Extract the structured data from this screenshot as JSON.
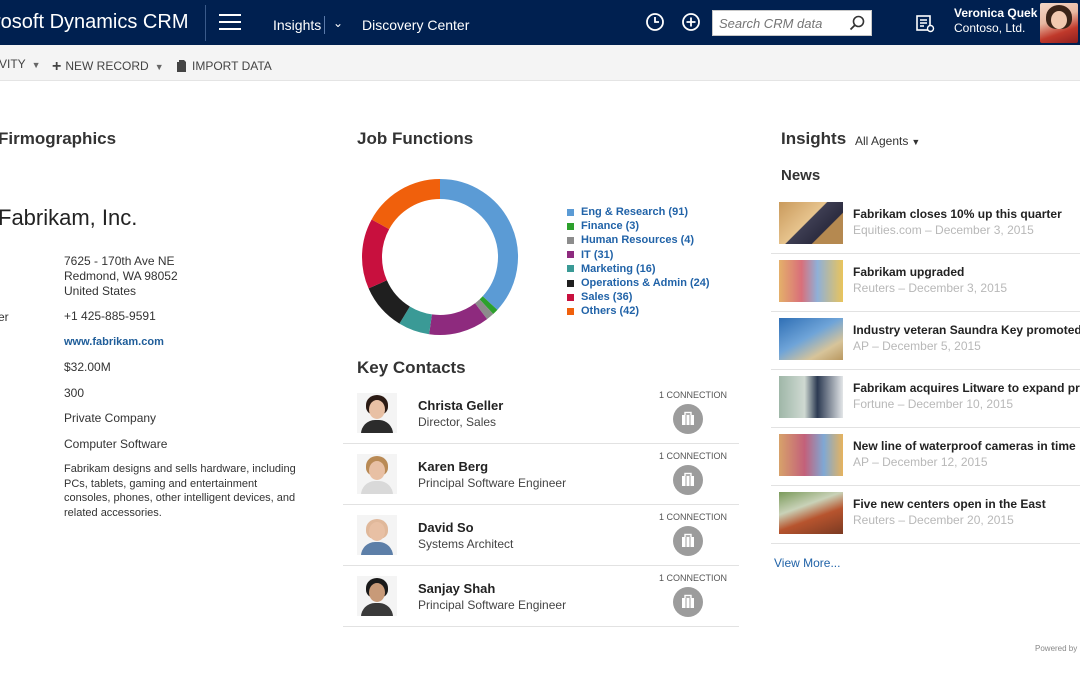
{
  "topbar": {
    "brand": "rosoft Dynamics CRM",
    "nav_insights": "Insights",
    "nav_discovery": "Discovery Center",
    "search_placeholder": "Search CRM data",
    "user_name": "Veronica Quek",
    "user_org": "Contoso, Ltd."
  },
  "cmdbar": {
    "activity": "VITY",
    "new_record": "NEW RECORD",
    "import_data": "IMPORT DATA"
  },
  "firmographics": {
    "title": "Firmographics",
    "company": "Fabrikam, Inc.",
    "address": [
      "7625 - 170th Ave NE",
      "Redmond, WA 98052",
      "United States"
    ],
    "phone_label": "er",
    "phone": "+1 425-885-9591",
    "website": "www.fabrikam.com",
    "revenue": "$32.00M",
    "employees": "300",
    "ownership": "Private Company",
    "industry": "Computer Software",
    "description": "Fabrikam designs and sells hardware, including PCs, tablets, gaming and entertainment consoles, phones, other intelligent devices, and related accessories."
  },
  "job_functions": {
    "title": "Job Functions",
    "legend": [
      {
        "label": "Eng & Research (91)",
        "color": "#5b9bd5"
      },
      {
        "label": "Finance (3)",
        "color": "#2ca02c"
      },
      {
        "label": "Human Resources (4)",
        "color": "#8c8c8c"
      },
      {
        "label": "IT (31)",
        "color": "#8e2a7e"
      },
      {
        "label": "Marketing (16)",
        "color": "#3a9a96"
      },
      {
        "label": "Operations & Admin (24)",
        "color": "#1f1f1f"
      },
      {
        "label": "Sales (36)",
        "color": "#c8103e"
      },
      {
        "label": "Others (42)",
        "color": "#f0600c"
      }
    ]
  },
  "chart_data": {
    "type": "pie",
    "title": "",
    "categories": [
      "Eng & Research",
      "Finance",
      "Human Resources",
      "IT",
      "Marketing",
      "Operations & Admin",
      "Sales",
      "Others"
    ],
    "values": [
      91,
      3,
      4,
      31,
      16,
      24,
      36,
      42
    ],
    "colors": [
      "#5b9bd5",
      "#2ca02c",
      "#8c8c8c",
      "#8e2a7e",
      "#3a9a96",
      "#1f1f1f",
      "#c8103e",
      "#f0600c"
    ],
    "legend": "right"
  },
  "key_contacts": {
    "title": "Key Contacts",
    "items": [
      {
        "name": "Christa Geller",
        "title": "Director, Sales",
        "connection": "1 CONNECTION"
      },
      {
        "name": "Karen Berg",
        "title": "Principal Software Engineer",
        "connection": "1 CONNECTION"
      },
      {
        "name": "David So",
        "title": "Systems Architect",
        "connection": "1 CONNECTION"
      },
      {
        "name": "Sanjay Shah",
        "title": "Principal Software Engineer",
        "connection": "1 CONNECTION"
      }
    ]
  },
  "insights": {
    "title": "Insights",
    "agents_dropdown": "All Agents",
    "news_title": "News",
    "news": [
      {
        "title": "Fabrikam closes 10% up this quarter",
        "meta": "Equities.com – December 3, 2015"
      },
      {
        "title": "Fabrikam upgraded",
        "meta": "Reuters – December 3, 2015"
      },
      {
        "title": "Industry veteran Saundra Key promoted",
        "meta": "AP – December 5, 2015"
      },
      {
        "title": "Fabrikam acquires Litware to expand pr",
        "meta": "Fortune – December 10, 2015"
      },
      {
        "title": "New line of waterproof cameras in time",
        "meta": "AP – December 12, 2015"
      },
      {
        "title": "Five new centers open in the East",
        "meta": "Reuters – December 20, 2015"
      }
    ],
    "view_more": "View More..."
  },
  "footer": {
    "powered_by": "Powered by"
  }
}
